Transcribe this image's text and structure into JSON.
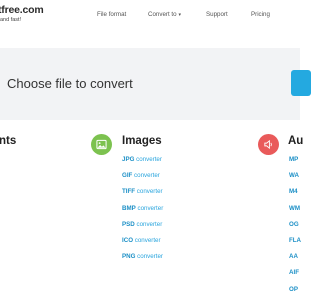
{
  "header": {
    "logo": "tfree.com",
    "tagline": "and fast!",
    "nav": [
      {
        "label": "File format"
      },
      {
        "label": "Convert to"
      },
      {
        "label": "Support"
      },
      {
        "label": "Pricing"
      }
    ]
  },
  "upload": {
    "title": "Choose file to convert"
  },
  "columns": {
    "documents": {
      "title": "nts",
      "items": [
        "",
        "",
        "",
        "",
        "",
        "",
        "",
        ""
      ]
    },
    "images": {
      "title": "Images",
      "items": [
        {
          "format": "JPG",
          "suffix": "converter"
        },
        {
          "format": "GIF",
          "suffix": "converter"
        },
        {
          "format": "TIFF",
          "suffix": "converter"
        },
        {
          "format": "BMP",
          "suffix": "converter"
        },
        {
          "format": "PSD",
          "suffix": "converter"
        },
        {
          "format": "ICO",
          "suffix": "converter"
        },
        {
          "format": "PNG",
          "suffix": "converter"
        }
      ]
    },
    "audio": {
      "title": "Au",
      "items": [
        "MP",
        "WA",
        "M4",
        "WM",
        "OG",
        "FLA",
        "AA",
        "AIF",
        "OP"
      ]
    }
  },
  "colors": {
    "accent": "#24a9e0",
    "images_icon": "#7cc24f",
    "audio_icon": "#e95a5a",
    "band": "#f2f3f5"
  },
  "icons": {
    "images": "image-icon",
    "audio": "speaker-icon"
  }
}
